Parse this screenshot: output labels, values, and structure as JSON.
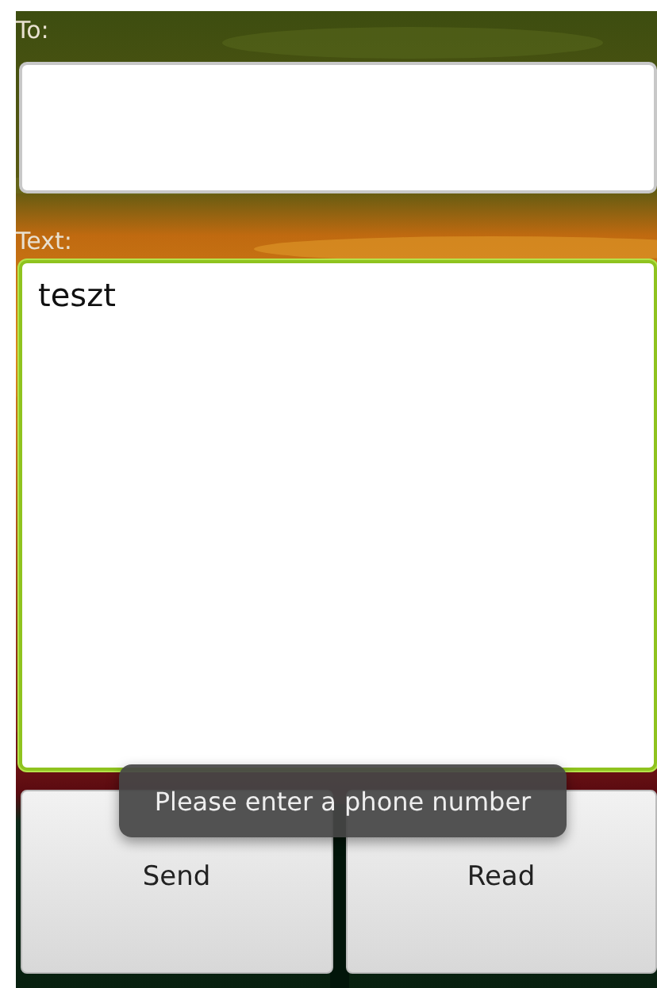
{
  "to": {
    "label": "To:",
    "focused": false
  },
  "text": {
    "label": "Text:",
    "value": "teszt",
    "focused": true
  },
  "buttons": [
    {
      "label": "Send"
    },
    {
      "label": "Read"
    }
  ],
  "toast": {
    "message": "Please enter a phone number"
  }
}
